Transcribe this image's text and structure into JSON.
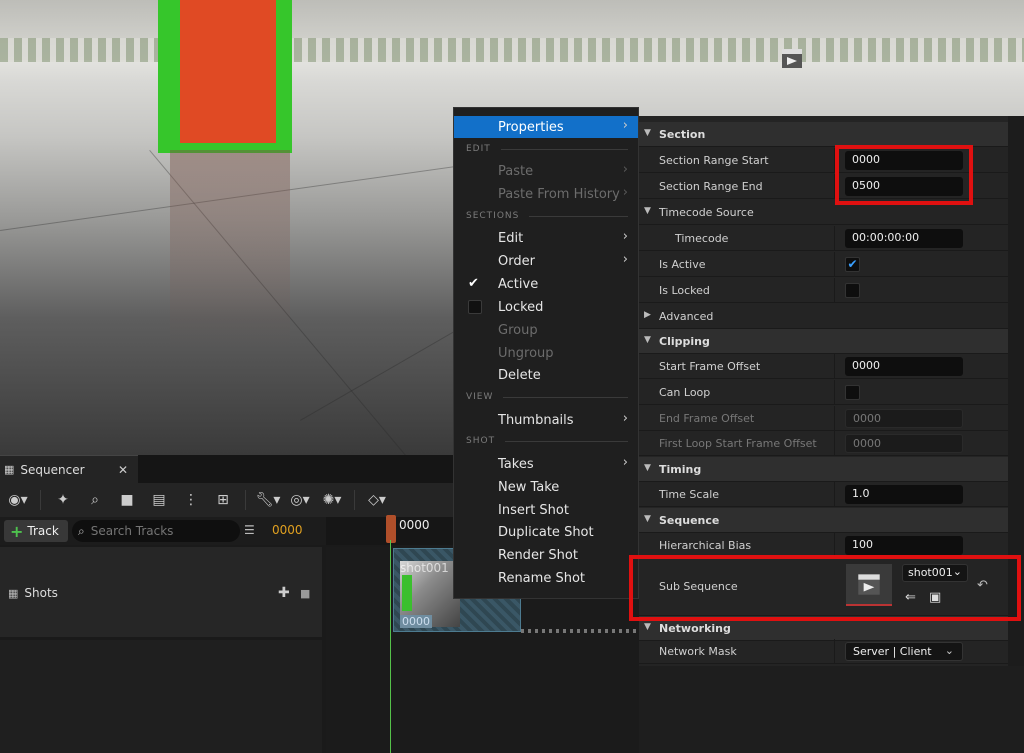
{
  "sequencer": {
    "tab_title": "Sequencer",
    "track_button": "Track",
    "search_placeholder": "Search Tracks",
    "frame_count": "0000",
    "ruler_start": "0000",
    "shots_label": "Shots",
    "clip_name": "shot001",
    "clip_start": "0000"
  },
  "context_menu": {
    "items": [
      {
        "label": "Properties"
      },
      {
        "section": "EDIT"
      },
      {
        "label": "Paste"
      },
      {
        "label": "Paste From History"
      },
      {
        "section": "SECTIONS"
      },
      {
        "label": "Edit"
      },
      {
        "label": "Order"
      },
      {
        "label": "Active"
      },
      {
        "label": "Locked"
      },
      {
        "label": "Group"
      },
      {
        "label": "Ungroup"
      },
      {
        "label": "Delete"
      },
      {
        "section": "VIEW"
      },
      {
        "label": "Thumbnails"
      },
      {
        "section": "SHOT"
      },
      {
        "label": "Takes"
      },
      {
        "label": "New Take"
      },
      {
        "label": "Insert Shot"
      },
      {
        "label": "Duplicate Shot"
      },
      {
        "label": "Render Shot"
      },
      {
        "label": "Rename Shot"
      }
    ]
  },
  "properties": {
    "rows": [
      {
        "label": "Section"
      },
      {
        "label": "Section Range Start",
        "value": "0000"
      },
      {
        "label": "Section Range End",
        "value": "0500"
      },
      {
        "label": "Timecode Source"
      },
      {
        "label": "Timecode",
        "value": "00:00:00:00"
      },
      {
        "label": "Is Active",
        "checked": true
      },
      {
        "label": "Is Locked",
        "checked": false
      },
      {
        "label": "Advanced"
      },
      {
        "label": "Clipping"
      },
      {
        "label": "Start Frame Offset",
        "value": "0000"
      },
      {
        "label": "Can Loop",
        "checked": false
      },
      {
        "label": "End Frame Offset",
        "value": "0000"
      },
      {
        "label": "First Loop Start Frame Offset",
        "value": "0000"
      },
      {
        "label": "Timing"
      },
      {
        "label": "Time Scale",
        "value": "1.0"
      },
      {
        "label": "Sequence"
      },
      {
        "label": "Hierarchical Bias",
        "value": "100"
      },
      {
        "label": "Sub Sequence",
        "value": "shot001"
      },
      {
        "label": "Networking"
      },
      {
        "label": "Network Mask",
        "value": "Server | Client"
      }
    ]
  },
  "colors": {
    "accent": "#1270c9",
    "highlight_box": "#e01010",
    "playhead": "#55c14a"
  }
}
